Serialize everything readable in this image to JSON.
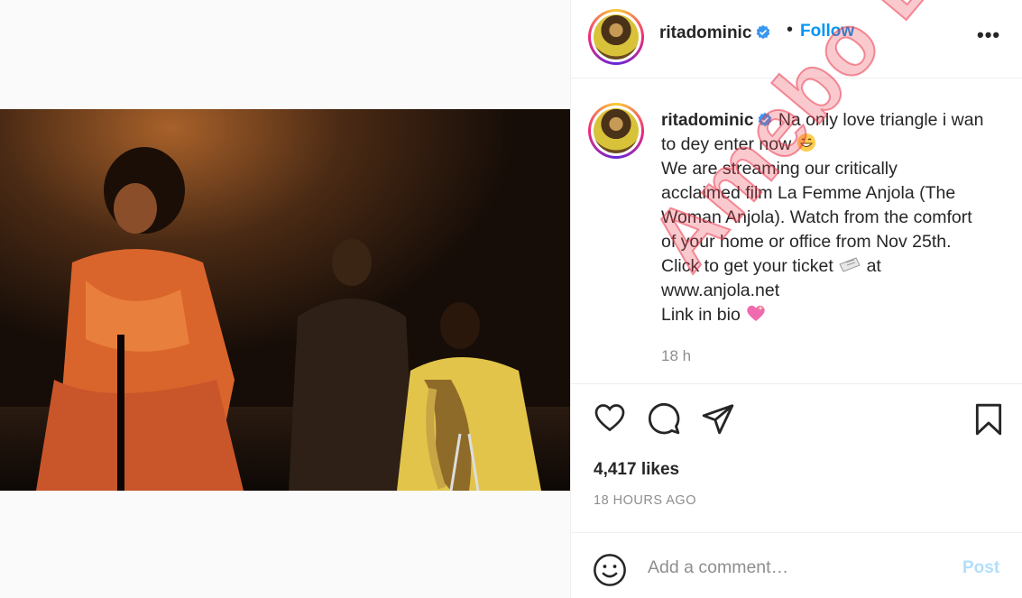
{
  "post": {
    "username": "ritadominic",
    "follow_label": "Follow",
    "more_label": "•••",
    "separator": "•",
    "caption_lines": [
      "Na only love triangle i wan",
      "to dey enter now",
      "We are streaming our critically",
      "acclaimed film La Femme Anjola (The",
      "Woman Anjola). Watch from the comfort",
      "of your home or office from Nov 25th.",
      "Click to get your ticket",
      "at",
      "www.anjola.net",
      "Link in bio"
    ],
    "caption_time": "18 h",
    "likes": "4,417 likes",
    "posted_ago": "18 HOURS AGO",
    "comment_placeholder": "Add a comment…",
    "post_label": "Post"
  },
  "watermark": "Amebo Book",
  "icons": {
    "verified": "verified-badge-icon",
    "like": "heart-icon",
    "comment": "comment-bubble-icon",
    "share": "paper-plane-icon",
    "save": "bookmark-icon",
    "emoji": "smiley-icon",
    "grin": "grinning-emoji",
    "ticket": "ticket-emoji",
    "heart_emoji": "sparkling-heart-emoji"
  },
  "colors": {
    "link_blue": "#0095f6",
    "post_disabled": "#b2dffc",
    "muted": "#8e8e8e",
    "verified": "#3897f0",
    "watermark": "#eb3c50"
  }
}
